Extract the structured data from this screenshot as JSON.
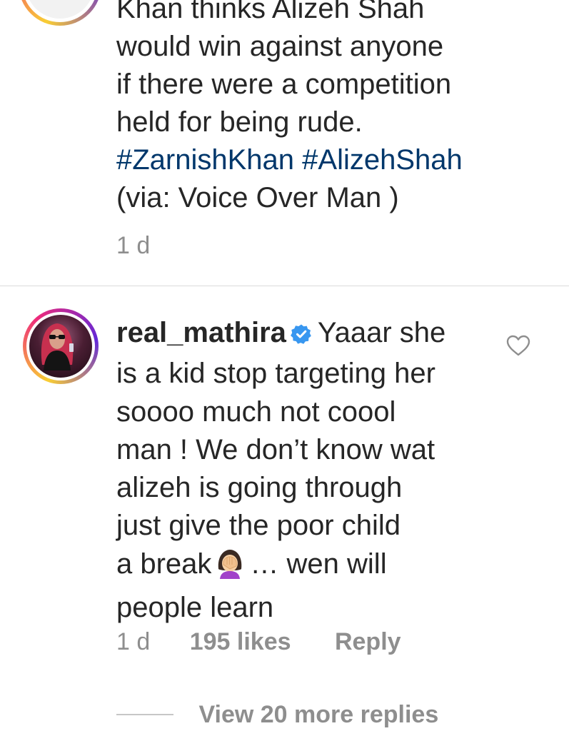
{
  "caption": {
    "lines": [
      "Khan thinks Alizeh Shah",
      "would win against anyone",
      "if there were a competition",
      "held for being rude."
    ],
    "hashtags": [
      "#ZarnishKhan",
      "#AlizehShah"
    ],
    "via": "(via: Voice Over Man )",
    "time": "1 d"
  },
  "comment": {
    "username": "real_mathira",
    "verified_icon": "verified-badge-icon",
    "first_line_text": "Yaaar she",
    "lines": [
      "is a kid stop targeting her",
      "soooo much not coool",
      "man ! We don’t know wat",
      "alizeh is going through",
      "just give the poor child"
    ],
    "line7_before_emoji": "a break",
    "emoji": "woman-facepalming-emoji",
    "line7_after_emoji": "… wen will",
    "last_line": "people learn",
    "time": "1 d",
    "likes": "195 likes",
    "reply_label": "Reply",
    "view_replies": "View 20 more replies",
    "like_icon": "heart-outline-icon"
  },
  "colors": {
    "text": "#262626",
    "hashtag": "#00376b",
    "meta": "#8e8e8e",
    "verified": "#3897f0"
  }
}
